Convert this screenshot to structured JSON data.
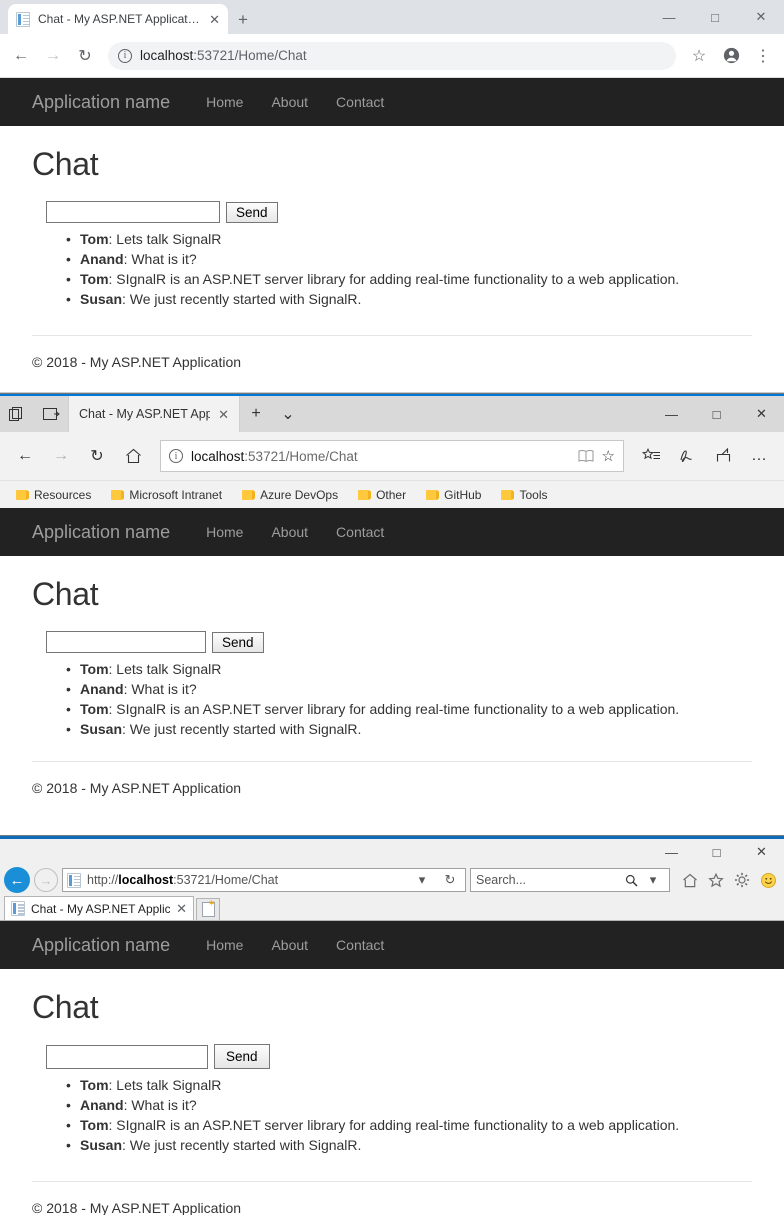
{
  "site": {
    "brand": "Application name",
    "nav": [
      "Home",
      "About",
      "Contact"
    ],
    "heading": "Chat",
    "send_label": "Send",
    "input_value": "",
    "input_placeholder": "",
    "messages": [
      {
        "user": "Tom",
        "sep": ": ",
        "text": "Lets talk SignalR"
      },
      {
        "user": "Anand",
        "sep": ": ",
        "text": "What is it?"
      },
      {
        "user": "Tom",
        "sep": ": ",
        "text": "SIgnalR is an ASP.NET server library for adding real-time functionality to a web application."
      },
      {
        "user": "Susan",
        "sep": ": ",
        "text": "We just recently started with SignalR."
      }
    ],
    "footer": "© 2018 - My ASP.NET Application"
  },
  "chrome": {
    "tab_title": "Chat - My ASP.NET Application",
    "tab_close": "✕",
    "new_tab": "+",
    "url_host": "localhost",
    "url_rest": ":53721/Home/Chat",
    "back_icon": "←",
    "forward_icon": "→",
    "reload_icon": "↻",
    "info_icon": "i",
    "star_icon": "☆",
    "profile_icon": "●",
    "menu_icon": "⋮",
    "minimize": "—",
    "maximize": "□",
    "close": "✕"
  },
  "edge": {
    "tab_title": "Chat - My ASP.NET App",
    "tab_close": "✕",
    "new_tab": "+",
    "tab_chevron": "⌄",
    "set_aside_icon": "set-tabs-aside",
    "tabs_aside_icon": "tabs-you-set-aside",
    "back_icon": "←",
    "forward_icon": "→",
    "refresh_icon": "↻",
    "home_icon": "⌂",
    "info_icon": "i",
    "url_host": "localhost",
    "url_rest": ":53721/Home/Chat",
    "reading_view_icon": "reading-view",
    "favorite_icon": "☆",
    "hub_icon": "hub",
    "notes_icon": "web-note",
    "share_icon": "share",
    "more_icon": "…",
    "minimize": "—",
    "maximize": "□",
    "close": "✕",
    "favorites": [
      "Resources",
      "Microsoft Intranet",
      "Azure DevOps",
      "Other",
      "GitHub",
      "Tools"
    ]
  },
  "ie": {
    "tab_title": "Chat - My ASP.NET Applica...",
    "tab_close": "✕",
    "url_scheme": "http://",
    "url_host": "localhost",
    "url_rest": ":53721/Home/Chat",
    "addr_dropdown": "▾",
    "refresh_icon": "↻",
    "search_placeholder": "Search...",
    "search_icon": "⚲",
    "search_dropdown": "▾",
    "back_icon": "←",
    "forward_icon": "→",
    "home_icon": "home-icon",
    "favorites_icon": "star-icon",
    "tools_icon": "gear-icon",
    "feedback_icon": "smiley-icon",
    "minimize": "—",
    "maximize": "□",
    "close": "✕"
  },
  "colors": {
    "navbar_bg": "#222222",
    "navbar_text": "#9d9d9d",
    "chrome_tabstrip": "#dee1e6",
    "edge_chrome_bg": "#f2f2f2",
    "edge_accent": "#0078d7",
    "ie_accent": "#0d6cb9",
    "ie_back_button": "#1a8fd8",
    "folder_yellow": "#ffc83d"
  }
}
